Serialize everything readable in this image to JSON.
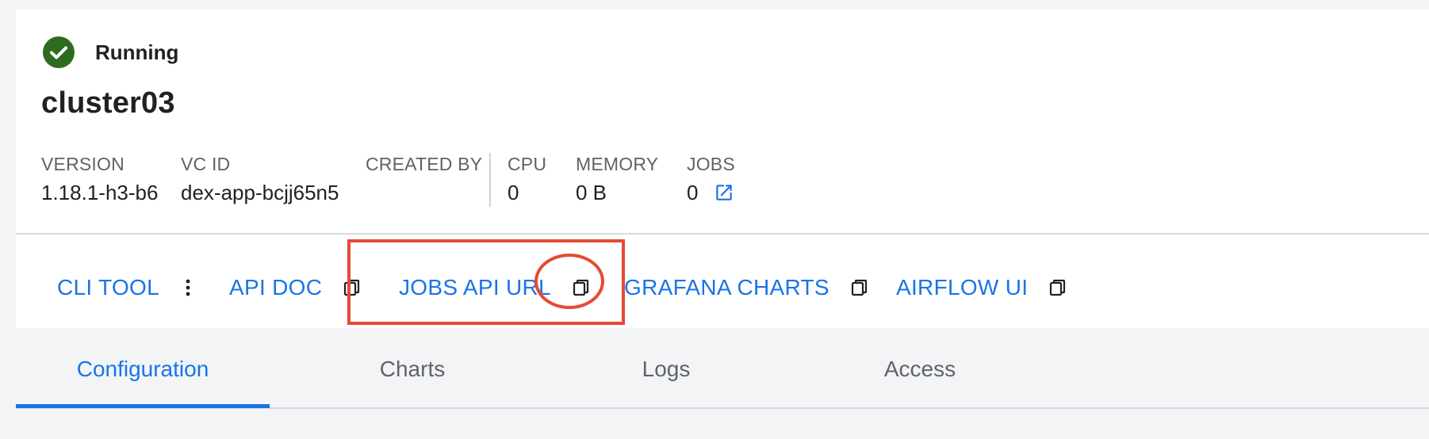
{
  "status": {
    "label": "Running",
    "icon": "check-circle-icon",
    "color": "#2f6b1f"
  },
  "cluster": {
    "name": "cluster03"
  },
  "meta": [
    {
      "label": "VERSION",
      "value": "1.18.1-h3-b6"
    },
    {
      "label": "VC ID",
      "value": "dex-app-bcjj65n5"
    },
    {
      "label": "CREATED BY",
      "value": ""
    },
    {
      "label": "CPU",
      "value": "0"
    },
    {
      "label": "MEMORY",
      "value": "0 B"
    },
    {
      "label": "JOBS",
      "value": "0",
      "icon": "external-link-icon"
    }
  ],
  "actions": [
    {
      "label": "CLI TOOL",
      "icon": "more-vertical-icon"
    },
    {
      "label": "API DOC",
      "icon": "copy-icon"
    },
    {
      "label": "JOBS API URL",
      "icon": "copy-icon",
      "highlighted": true
    },
    {
      "label": "GRAFANA CHARTS",
      "icon": "copy-icon"
    },
    {
      "label": "AIRFLOW UI",
      "icon": "copy-icon"
    }
  ],
  "tabs": [
    {
      "label": "Configuration",
      "active": true
    },
    {
      "label": "Charts",
      "active": false
    },
    {
      "label": "Logs",
      "active": false
    },
    {
      "label": "Access",
      "active": false
    }
  ],
  "colors": {
    "accent": "#1a73e8",
    "highlight": "#e54a35",
    "page_background": "#f3f4f6",
    "card_background": "#ffffff"
  }
}
